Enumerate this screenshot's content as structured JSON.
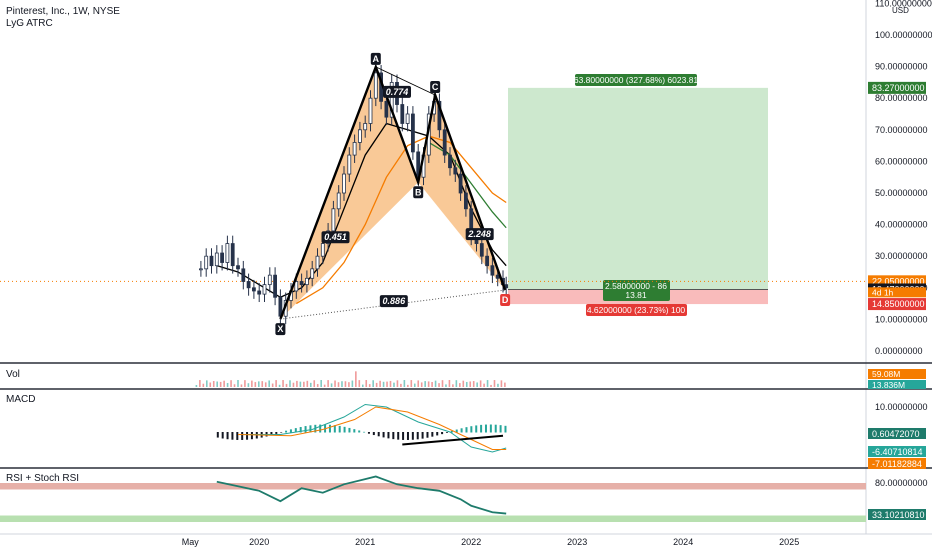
{
  "header": {
    "title": "Pinterest, Inc., 1W, NYSE",
    "indicator": "LyG ATRC"
  },
  "currency": "USD",
  "colors": {
    "orange": "#f57c00",
    "green": "#2e7d32",
    "black": "#000000",
    "candle": "#26324a",
    "fill_harmonic": "#f6b26b",
    "profit": "#c8e6c9",
    "loss": "#f8b4b4",
    "teal": "#1e7b6b",
    "rsi_band_high": "#e6b0a8",
    "rsi_band_low": "#b8e0b0"
  },
  "price_axis": {
    "ticks": [
      "110.00000000",
      "100.00000000",
      "90.00000000",
      "80.00000000",
      "70.00000000",
      "60.00000000",
      "50.00000000",
      "40.00000000",
      "30.00000000",
      "20.00000000",
      "10.00000000",
      "0.00000000"
    ],
    "tick_values": [
      110,
      100,
      90,
      80,
      70,
      60,
      50,
      40,
      30,
      20,
      10,
      0
    ]
  },
  "time_axis": {
    "labels": [
      "May",
      "2020",
      "2021",
      "2022",
      "2023",
      "2024",
      "2025"
    ]
  },
  "price_tags": [
    {
      "label": "83.27000000",
      "value": 83.27,
      "color": "#2e7d32"
    },
    {
      "label": "22.05000000",
      "value": 22.05,
      "color": "#f57c00"
    },
    {
      "label": "19.47000000",
      "value": 19.47,
      "color": "#131722"
    },
    {
      "label": "14.85000000",
      "value": 14.85,
      "color": "#e53935"
    }
  ],
  "countdown": "4d 1h",
  "pattern": {
    "points": [
      {
        "label": "X",
        "time": 2020.2,
        "price": 10.1
      },
      {
        "label": "A",
        "time": 2021.1,
        "price": 89.9
      },
      {
        "label": "B",
        "time": 2021.5,
        "price": 53.4
      },
      {
        "label": "C",
        "time": 2021.66,
        "price": 81.0
      },
      {
        "label": "D",
        "time": 2022.32,
        "price": 19.3
      }
    ],
    "ratios": [
      {
        "label": "0.451",
        "time": 2020.72,
        "price": 36
      },
      {
        "label": "0.774",
        "time": 2021.3,
        "price": 82
      },
      {
        "label": "2.248",
        "time": 2022.08,
        "price": 37
      },
      {
        "label": "0.886",
        "time": 2021.27,
        "price": 15.8
      }
    ]
  },
  "position": {
    "target_label": "63.80000000 (327.68%) 6023.81",
    "entry_label": "2.58000000 - 86",
    "entry_sub": "13.81",
    "stop_label": "4.62000000 (23.73%) 100",
    "target": 83.27,
    "entry": 19.47,
    "stop": 14.85
  },
  "volume_pane": {
    "label": "Vol",
    "tag1": "59.08M",
    "tag2": "13.836M"
  },
  "macd_pane": {
    "label": "MACD",
    "ticks": [
      "10.00000000"
    ],
    "tags": [
      {
        "label": "0.60472070",
        "color": "#1e7b6b"
      },
      {
        "label": "-6.40710814",
        "color": "#26a69a"
      },
      {
        "label": "-7.01182884",
        "color": "#f57c00"
      }
    ]
  },
  "rsi_pane": {
    "label": "RSI + Stoch RSI",
    "ticks": [
      "80.00000000"
    ],
    "tag": "33.10210810",
    "band_high": [
      70,
      80
    ],
    "band_low": [
      20,
      30
    ]
  },
  "chart_data": {
    "type": "candlestick",
    "title": "Pinterest, Inc., 1W, NYSE",
    "x_unit": "year",
    "ylim": [
      0,
      110
    ],
    "close_series": [
      [
        2019.45,
        26
      ],
      [
        2019.5,
        30
      ],
      [
        2019.55,
        27
      ],
      [
        2019.6,
        31
      ],
      [
        2019.65,
        28
      ],
      [
        2019.7,
        34
      ],
      [
        2019.75,
        27
      ],
      [
        2019.8,
        26
      ],
      [
        2019.85,
        22
      ],
      [
        2019.9,
        20
      ],
      [
        2019.95,
        19
      ],
      [
        2020.0,
        18
      ],
      [
        2020.05,
        21
      ],
      [
        2020.1,
        24
      ],
      [
        2020.15,
        17
      ],
      [
        2020.2,
        11
      ],
      [
        2020.25,
        16
      ],
      [
        2020.3,
        19
      ],
      [
        2020.35,
        22
      ],
      [
        2020.4,
        21
      ],
      [
        2020.45,
        23
      ],
      [
        2020.5,
        26
      ],
      [
        2020.55,
        30
      ],
      [
        2020.6,
        34
      ],
      [
        2020.65,
        38
      ],
      [
        2020.7,
        45
      ],
      [
        2020.75,
        50
      ],
      [
        2020.8,
        56
      ],
      [
        2020.85,
        62
      ],
      [
        2020.9,
        66
      ],
      [
        2020.95,
        70
      ],
      [
        2021.0,
        72
      ],
      [
        2021.05,
        80
      ],
      [
        2021.1,
        88
      ],
      [
        2021.15,
        79
      ],
      [
        2021.2,
        74
      ],
      [
        2021.25,
        85
      ],
      [
        2021.3,
        78
      ],
      [
        2021.35,
        72
      ],
      [
        2021.4,
        75
      ],
      [
        2021.45,
        63
      ],
      [
        2021.5,
        55
      ],
      [
        2021.55,
        62
      ],
      [
        2021.6,
        75
      ],
      [
        2021.65,
        79
      ],
      [
        2021.7,
        70
      ],
      [
        2021.75,
        62
      ],
      [
        2021.8,
        58
      ],
      [
        2021.85,
        56
      ],
      [
        2021.9,
        50
      ],
      [
        2021.95,
        45
      ],
      [
        2022.0,
        36
      ],
      [
        2022.05,
        34
      ],
      [
        2022.1,
        30
      ],
      [
        2022.15,
        27
      ],
      [
        2022.2,
        24
      ],
      [
        2022.25,
        23
      ],
      [
        2022.3,
        21
      ],
      [
        2022.33,
        20
      ]
    ],
    "series": [
      {
        "color": "black",
        "values": [
          [
            2019.6,
            27
          ],
          [
            2019.8,
            25
          ],
          [
            2020.0,
            21
          ],
          [
            2020.2,
            17
          ],
          [
            2020.4,
            20
          ],
          [
            2020.6,
            28
          ],
          [
            2020.8,
            45
          ],
          [
            2021.0,
            62
          ],
          [
            2021.2,
            72
          ],
          [
            2021.4,
            70
          ],
          [
            2021.6,
            68
          ],
          [
            2021.8,
            62
          ],
          [
            2022.0,
            45
          ],
          [
            2022.2,
            32
          ],
          [
            2022.33,
            27
          ]
        ]
      },
      {
        "color": "orange",
        "values": [
          [
            2020.35,
            15
          ],
          [
            2020.6,
            20
          ],
          [
            2020.8,
            28
          ],
          [
            2021.0,
            40
          ],
          [
            2021.2,
            55
          ],
          [
            2021.4,
            65
          ],
          [
            2021.6,
            68
          ],
          [
            2021.8,
            66
          ],
          [
            2022.0,
            58
          ],
          [
            2022.2,
            50
          ],
          [
            2022.33,
            47
          ]
        ]
      },
      {
        "color": "green",
        "values": [
          [
            2021.6,
            66
          ],
          [
            2021.8,
            62
          ],
          [
            2022.0,
            53
          ],
          [
            2022.2,
            44
          ],
          [
            2022.33,
            39
          ]
        ]
      }
    ]
  }
}
